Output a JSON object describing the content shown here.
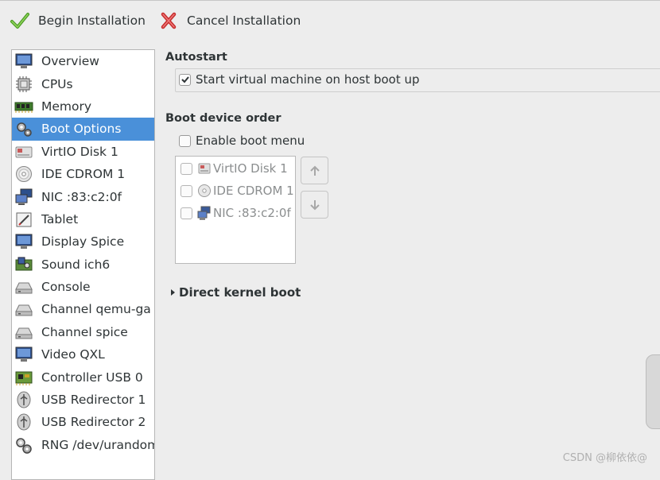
{
  "toolbar": {
    "begin_label": "Begin Installation",
    "cancel_label": "Cancel Installation"
  },
  "sidebar": {
    "selected_index": 3,
    "items": [
      {
        "label": "Overview",
        "icon": "monitor-icon"
      },
      {
        "label": "CPUs",
        "icon": "cpu-chip-icon"
      },
      {
        "label": "Memory",
        "icon": "memory-module-icon"
      },
      {
        "label": "Boot Options",
        "icon": "gears-icon"
      },
      {
        "label": "VirtIO Disk 1",
        "icon": "hard-disk-icon"
      },
      {
        "label": "IDE CDROM 1",
        "icon": "cdrom-icon"
      },
      {
        "label": "NIC :83:c2:0f",
        "icon": "network-icon"
      },
      {
        "label": "Tablet",
        "icon": "tablet-icon"
      },
      {
        "label": "Display Spice",
        "icon": "display-icon"
      },
      {
        "label": "Sound ich6",
        "icon": "sound-card-icon"
      },
      {
        "label": "Console",
        "icon": "serial-console-icon"
      },
      {
        "label": "Channel qemu-ga",
        "icon": "channel-icon"
      },
      {
        "label": "Channel spice",
        "icon": "channel-icon"
      },
      {
        "label": "Video QXL",
        "icon": "video-card-icon"
      },
      {
        "label": "Controller USB 0",
        "icon": "controller-card-icon"
      },
      {
        "label": "USB Redirector 1",
        "icon": "usb-icon"
      },
      {
        "label": "USB Redirector 2",
        "icon": "usb-icon"
      },
      {
        "label": "RNG /dev/urandom",
        "icon": "rng-gears-icon"
      }
    ]
  },
  "autostart": {
    "title": "Autostart",
    "checkbox_label": "Start virtual machine on host boot up",
    "checked": true
  },
  "boot_order": {
    "title": "Boot device order",
    "enable_menu_label": "Enable boot menu",
    "enable_menu_checked": false,
    "devices": [
      {
        "label": "VirtIO Disk 1",
        "icon": "hard-disk-icon",
        "checked": false
      },
      {
        "label": "IDE CDROM 1",
        "icon": "cdrom-icon",
        "checked": false
      },
      {
        "label": "NIC :83:c2:0f",
        "icon": "network-icon",
        "checked": false
      }
    ],
    "move_up_icon": "arrow-up-icon",
    "move_down_icon": "arrow-down-icon"
  },
  "kernel_boot": {
    "label": "Direct kernel boot",
    "expanded": false
  },
  "watermark": "CSDN @柳依依@",
  "colors": {
    "selection": "#4a90d9",
    "accept_green": "#5aa52a",
    "cancel_red": "#d23b3b"
  }
}
